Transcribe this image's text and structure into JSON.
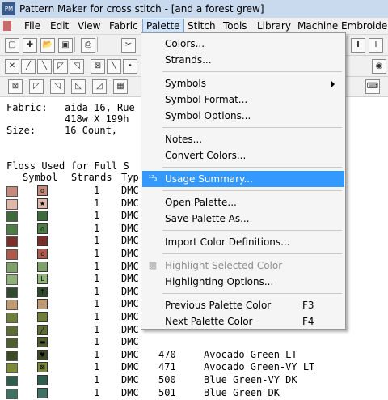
{
  "window": {
    "title": "Pattern Maker for cross stitch - [and a forest grew]",
    "icon_label": "PM"
  },
  "menubar": {
    "items": [
      "File",
      "Edit",
      "View",
      "Fabric",
      "Palette",
      "Stitch",
      "Tools",
      "Library",
      "Machine Embroidery"
    ],
    "active": "Palette"
  },
  "document": {
    "fabric_label": "Fabric:",
    "fabric_value": "aida 16, Rue",
    "fabric_dims": "418w X 199h",
    "size_label": "Size:",
    "size_value": "16 Count,",
    "floss_heading": "Floss Used for Full S",
    "columns": [
      "Symbol",
      "Strands",
      "Typ"
    ],
    "rows": [
      {
        "color": "#c58a7c",
        "sym": "o",
        "strands": "1",
        "type": "DMC",
        "num": "",
        "name": ""
      },
      {
        "color": "#e0b6a8",
        "sym": "★",
        "strands": "1",
        "type": "DMC",
        "num": "",
        "name": ""
      },
      {
        "color": "#3f6b3a",
        "sym": "",
        "strands": "1",
        "type": "DMC",
        "num": "",
        "name": ""
      },
      {
        "color": "#4d7d45",
        "sym": "∩",
        "strands": "1",
        "type": "DMC",
        "num": "",
        "name": ""
      },
      {
        "color": "#7a2f2a",
        "sym": "·",
        "strands": "1",
        "type": "DMC",
        "num": "",
        "name": ""
      },
      {
        "color": "#b05a4e",
        "sym": "c",
        "strands": "1",
        "type": "DMC",
        "num": "",
        "name": ""
      },
      {
        "color": "#7ea06a",
        "sym": "",
        "strands": "1",
        "type": "DMC",
        "num": "",
        "name": ""
      },
      {
        "color": "#8fb27a",
        "sym": "L",
        "strands": "1",
        "type": "DMC",
        "num": "",
        "name": ""
      },
      {
        "color": "#2f4a2c",
        "sym": "↑",
        "strands": "1",
        "type": "DMC",
        "num": "",
        "name": ""
      },
      {
        "color": "#c09a72",
        "sym": "‒",
        "strands": "1",
        "type": "DMC",
        "num": "",
        "name": ""
      },
      {
        "color": "#6f7f3c",
        "sym": "",
        "strands": "1",
        "type": "DMC",
        "num": "",
        "name": ""
      },
      {
        "color": "#5d6d35",
        "sym": "╱",
        "strands": "1",
        "type": "DMC",
        "num": "",
        "name": ""
      },
      {
        "color": "#4f5e2e",
        "sym": "▬",
        "strands": "1",
        "type": "DMC",
        "num": "",
        "name": ""
      },
      {
        "color": "#3c4a24",
        "sym": "♥",
        "strands": "1",
        "type": "DMC",
        "num": "470",
        "name": "Avocado Green LT"
      },
      {
        "color": "#7c8a3a",
        "sym": "⊠",
        "strands": "1",
        "type": "DMC",
        "num": "471",
        "name": "Avocado Green-VY LT"
      },
      {
        "color": "#2e5f4e",
        "sym": "",
        "strands": "1",
        "type": "DMC",
        "num": "500",
        "name": "Blue Green-VY DK"
      },
      {
        "color": "#3f7262",
        "sym": "",
        "strands": "1",
        "type": "DMC",
        "num": "501",
        "name": "Blue Green DK"
      }
    ]
  },
  "palette_menu": {
    "items": [
      {
        "label": "Colors...",
        "key": "",
        "type": "item"
      },
      {
        "label": "Strands...",
        "key": "",
        "type": "item"
      },
      {
        "type": "sep"
      },
      {
        "label": "Symbols",
        "key": "",
        "type": "submenu"
      },
      {
        "label": "Symbol Format...",
        "key": "",
        "type": "item"
      },
      {
        "label": "Symbol Options...",
        "key": "",
        "type": "item"
      },
      {
        "type": "sep"
      },
      {
        "label": "Notes...",
        "key": "",
        "type": "item"
      },
      {
        "label": "Convert Colors...",
        "key": "",
        "type": "item"
      },
      {
        "type": "sep"
      },
      {
        "label": "Usage Summary...",
        "key": "",
        "type": "highlighted",
        "icon": "usage-summary-icon"
      },
      {
        "type": "sep"
      },
      {
        "label": "Open Palette...",
        "key": "",
        "type": "item"
      },
      {
        "label": "Save Palette As...",
        "key": "",
        "type": "item"
      },
      {
        "type": "sep"
      },
      {
        "label": "Import Color Definitions...",
        "key": "",
        "type": "item"
      },
      {
        "type": "sep"
      },
      {
        "label": "Highlight Selected Color",
        "key": "",
        "type": "disabled",
        "icon": "checkerboard-icon"
      },
      {
        "label": "Highlighting Options...",
        "key": "",
        "type": "item"
      },
      {
        "type": "sep"
      },
      {
        "label": "Previous Palette Color",
        "key": "F3",
        "type": "item"
      },
      {
        "label": "Next Palette Color",
        "key": "F4",
        "type": "item"
      }
    ]
  },
  "colors": {
    "highlight": "#3399ff",
    "menu_bg": "#f5f5f5",
    "titlebar": "#c9d9ee"
  }
}
